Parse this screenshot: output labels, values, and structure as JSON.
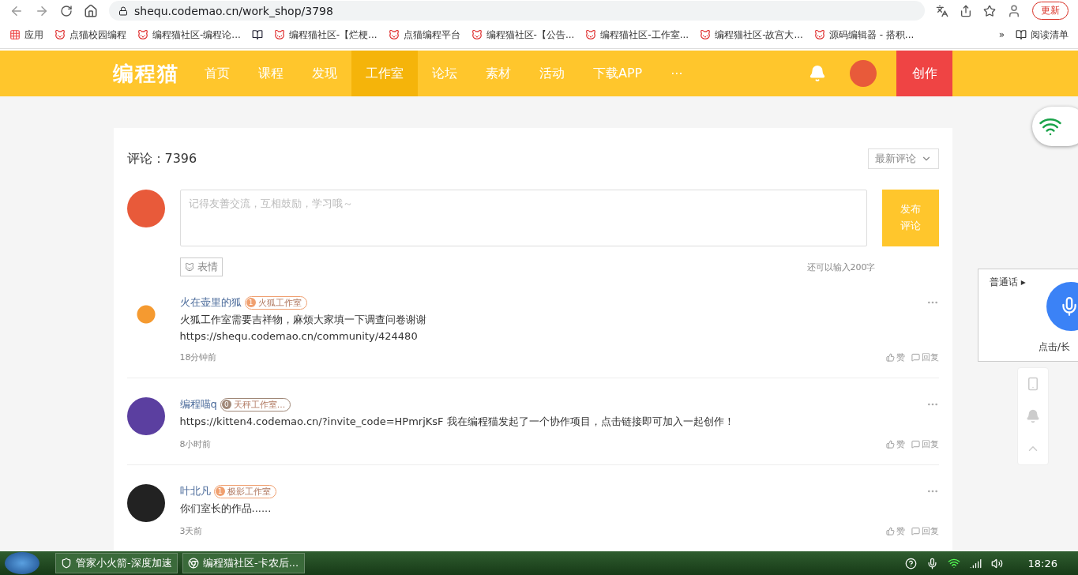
{
  "browser": {
    "url": "shequ.codemao.cn/work_shop/3798",
    "update_button": "更新",
    "apps_label": "应用",
    "bookmarks": [
      {
        "kind": "site",
        "label": "点猫校园编程"
      },
      {
        "kind": "site",
        "label": "编程猫社区-编程论..."
      },
      {
        "kind": "folder"
      },
      {
        "kind": "site",
        "label": "编程猫社区-【烂梗..."
      },
      {
        "kind": "site",
        "label": "点猫编程平台"
      },
      {
        "kind": "site",
        "label": "编程猫社区-【公告..."
      },
      {
        "kind": "site",
        "label": "编程猫社区-工作室..."
      },
      {
        "kind": "site",
        "label": "编程猫社区-故宫大..."
      },
      {
        "kind": "site",
        "label": "源码编辑器 - 搭积..."
      }
    ],
    "more": "»",
    "reading_list": "阅读清单"
  },
  "nav": {
    "logo": "编程猫",
    "items": [
      {
        "label": "首页",
        "selected": false
      },
      {
        "label": "课程",
        "selected": false
      },
      {
        "label": "发现",
        "selected": false
      },
      {
        "label": "工作室",
        "selected": true
      },
      {
        "label": "论坛",
        "selected": false
      },
      {
        "label": "素材",
        "selected": false
      },
      {
        "label": "活动",
        "selected": false
      },
      {
        "label": "下载APP",
        "selected": false
      },
      {
        "label": "···",
        "selected": false
      }
    ],
    "create_button": "创作"
  },
  "comments": {
    "count_label": "评论：7396",
    "sort": "最新评论",
    "placeholder": "记得友善交流，互相鼓励，学习哦～",
    "submit": "发布评论",
    "emoji_button": "表情",
    "remaining": "还可以输入200字",
    "list": [
      {
        "author": "火在壶里的狐",
        "level": "1",
        "studio": "火狐工作室",
        "color": "#f0a070",
        "lines": [
          "火狐工作室需要吉祥物，麻烦大家填一下调查问卷谢谢",
          "https://shequ.codemao.cn/community/424480"
        ],
        "time": "18分钟前",
        "like": "赞",
        "reply": "回复",
        "kind": "fox"
      },
      {
        "author": "编程喵q",
        "level": "0",
        "studio": "天秤工作室...",
        "color": "#a08878",
        "lines": [
          "https://kitten4.codemao.cn/?invite_code=HPmrjKsF 我在编程猫发起了一个协作项目，点击链接即可加入一起创作！"
        ],
        "time": "8小时前",
        "like": "赞",
        "reply": "回复",
        "kind": "purple"
      },
      {
        "author": "叶北凡",
        "level": "1",
        "studio": "极影工作室",
        "color": "#f0a070",
        "lines": [
          "你们室长的作品......"
        ],
        "time": "3天前",
        "like": "赞",
        "reply": "回复",
        "kind": "dark"
      }
    ]
  },
  "voice_popup": {
    "language": "普通话",
    "arrow": "▸",
    "hint": "点击/长"
  },
  "taskbar": {
    "items": [
      "管家小火箭-深度加速",
      "编程猫社区-卡农后..."
    ],
    "clock": "18:26"
  }
}
